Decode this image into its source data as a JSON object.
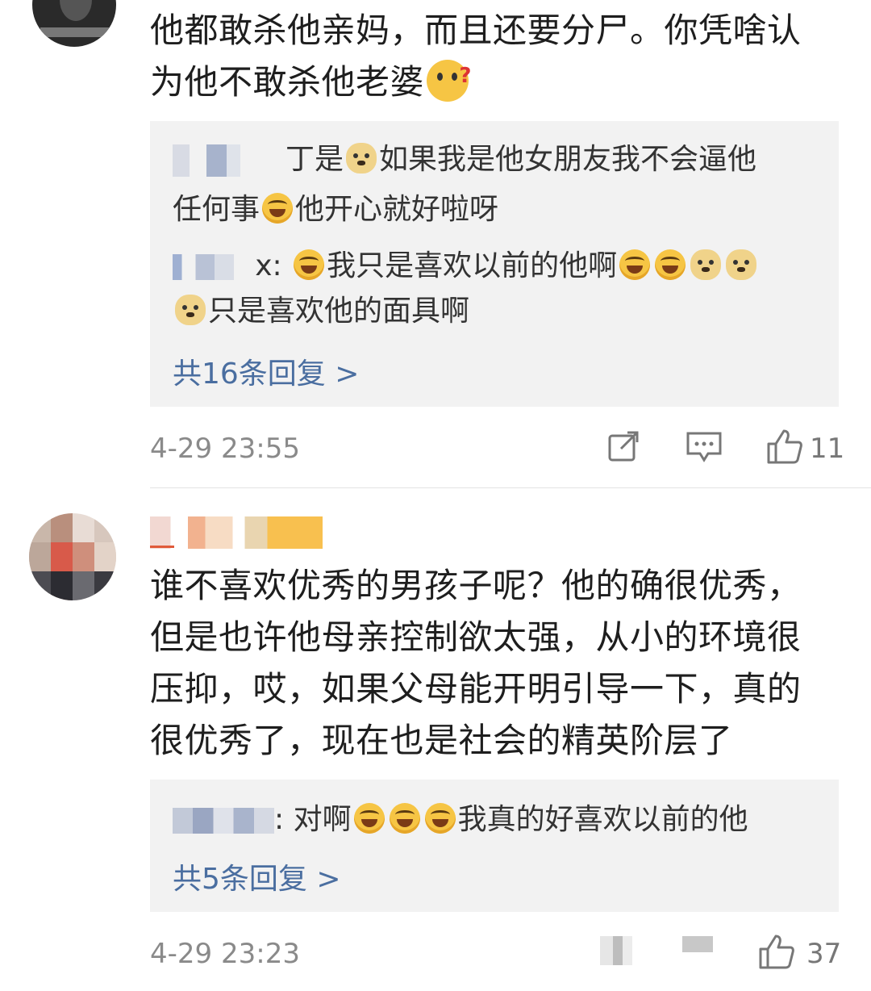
{
  "comments": [
    {
      "text_line1": "他都敢杀他亲妈，而且还要分尸。你凭啥认",
      "text_line2": "为他不敢杀他老婆",
      "emoji_end": "question-face-emoji",
      "replies": [
        {
          "user_suffix": "丁是",
          "text_a": "如果我是他女朋友我不会逼他",
          "text_b": "任何事",
          "text_c": "他开心就好啦呀"
        },
        {
          "user_suffix": " x: ",
          "text_a": "我只是喜欢以前的他啊",
          "text_b": "只是喜欢他的面具啊"
        }
      ],
      "more_replies": "共16条回复 >",
      "time": "4-29 23:55",
      "like_count": "11"
    },
    {
      "text_lines": [
        "谁不喜欢优秀的男孩子呢？他的确很优秀，",
        "但是也许他母亲控制欲太强，从小的环境很",
        "压抑，哎，如果父母能开明引导一下，真的",
        "很优秀了，现在也是社会的精英阶层了"
      ],
      "replies": [
        {
          "user_suffix": ": ",
          "text_a": "对啊",
          "text_b": "我真的好喜欢以前的他"
        }
      ],
      "more_replies": "共5条回复 >",
      "time": "4-29 23:23",
      "like_count": "37"
    }
  ],
  "colors": {
    "link": "#4a6ea0",
    "reply_bg": "#f2f2f2",
    "meta": "#8a8a8a"
  }
}
